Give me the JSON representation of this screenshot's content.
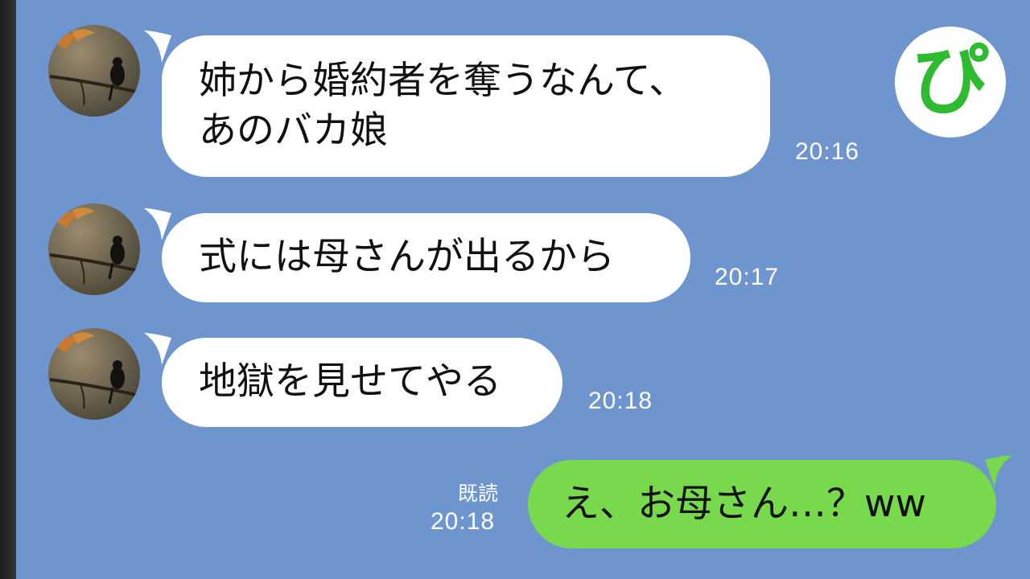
{
  "badge": {
    "text": "ぴ",
    "color": "#2fbb2f"
  },
  "colors": {
    "background": "#6f95cf",
    "incoming_bubble": "#ffffff",
    "outgoing_bubble": "#77d94b",
    "timestamp_text": "#ffffff"
  },
  "messages": [
    {
      "direction": "incoming",
      "avatar": "bird-on-branch-avatar",
      "text": "姉から婚約者を奪うなんて、\nあのバカ娘",
      "time": "20:16"
    },
    {
      "direction": "incoming",
      "avatar": "bird-on-branch-avatar",
      "text": "式には母さんが出るから",
      "time": "20:17"
    },
    {
      "direction": "incoming",
      "avatar": "bird-on-branch-avatar",
      "text": "地獄を見せてやる",
      "time": "20:18"
    },
    {
      "direction": "outgoing",
      "text": "え、お母さん…？ww",
      "read_label": "既読",
      "time": "20:18"
    }
  ]
}
